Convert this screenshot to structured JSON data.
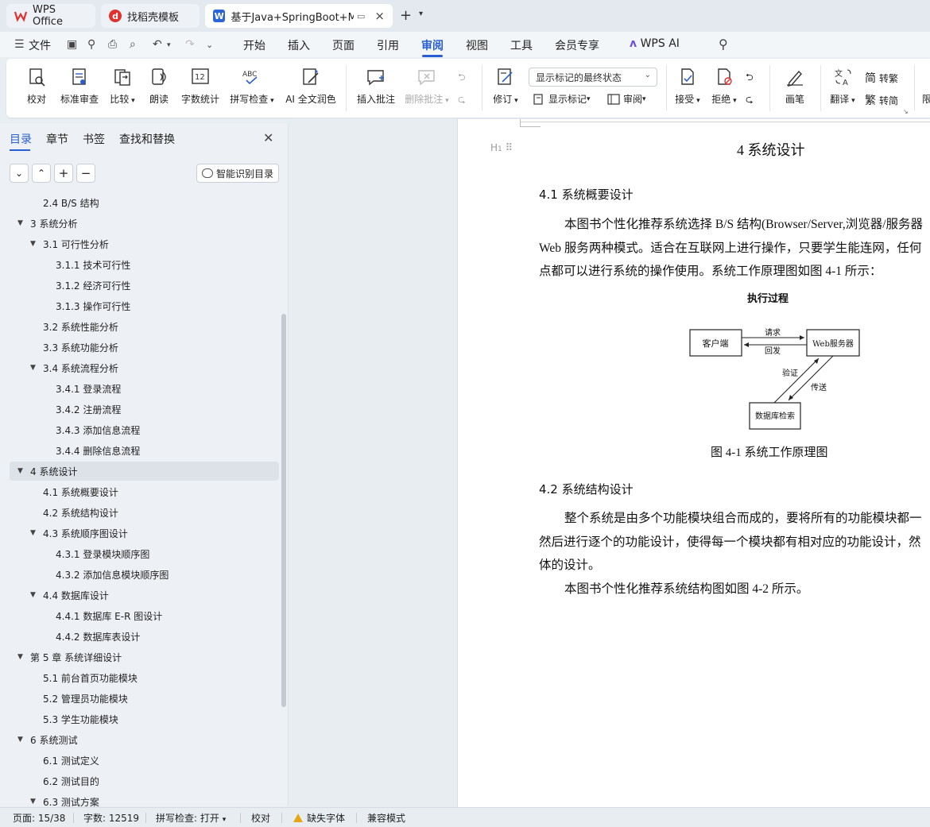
{
  "tabs": [
    {
      "label": "WPS Office",
      "icon": "wps-logo-icon"
    },
    {
      "label": "找稻壳模板",
      "icon": "docer-logo-icon"
    },
    {
      "label": "基于Java+SpringBoot+MyS",
      "icon": "writer-doc-icon",
      "active": true
    }
  ],
  "menu": {
    "file": "文件",
    "items": [
      "开始",
      "插入",
      "页面",
      "引用",
      "审阅",
      "视图",
      "工具",
      "会员专享"
    ],
    "active": "审阅",
    "wps_ai": "WPS AI"
  },
  "ribbon": {
    "proofread": "校对",
    "standard_review": "标准审查",
    "compare": "比较",
    "read_aloud": "朗读",
    "word_count": "字数统计",
    "spell_check": "拼写检查",
    "ai_polish": "AI 全文润色",
    "insert_comment": "插入批注",
    "delete_comment": "删除批注",
    "revise": "修订",
    "markup_select": "显示标记的最终状态",
    "show_markup": "显示标记",
    "review": "审阅",
    "accept": "接受",
    "reject": "拒绝",
    "pen": "画笔",
    "translate": "翻译",
    "to_traditional": "转繁",
    "to_simplified": "转简",
    "overflow": "限"
  },
  "nav": {
    "tabs": [
      "目录",
      "章节",
      "书签",
      "查找和替换"
    ],
    "active_tab": "目录",
    "smart_button": "智能识别目录",
    "toc": [
      {
        "text": "2.4 B/S 结构",
        "level": 2,
        "expander": false
      },
      {
        "text": "3  系统分析",
        "level": 1,
        "expander": true
      },
      {
        "text": "3.1  可行性分析",
        "level": 2,
        "expander": true
      },
      {
        "text": "3.1.1  技术可行性",
        "level": 3,
        "expander": false
      },
      {
        "text": "3.1.2 经济可行性",
        "level": 3,
        "expander": false
      },
      {
        "text": "3.1.3 操作可行性",
        "level": 3,
        "expander": false
      },
      {
        "text": "3.2  系统性能分析",
        "level": 2,
        "expander": false
      },
      {
        "text": "3.3  系统功能分析",
        "level": 2,
        "expander": false
      },
      {
        "text": "3.4 系统流程分析",
        "level": 2,
        "expander": true
      },
      {
        "text": "3.4.1 登录流程",
        "level": 3,
        "expander": false
      },
      {
        "text": "3.4.2 注册流程",
        "level": 3,
        "expander": false
      },
      {
        "text": "3.4.3 添加信息流程",
        "level": 3,
        "expander": false
      },
      {
        "text": "3.4.4 删除信息流程",
        "level": 3,
        "expander": false
      },
      {
        "text": "4   系统设计",
        "level": 1,
        "expander": true,
        "selected": true
      },
      {
        "text": "4.1 系统概要设计",
        "level": 2,
        "expander": false
      },
      {
        "text": "4.2 系统结构设计",
        "level": 2,
        "expander": false
      },
      {
        "text": "4.3 系统顺序图设计",
        "level": 2,
        "expander": true
      },
      {
        "text": "4.3.1 登录模块顺序图",
        "level": 3,
        "expander": false
      },
      {
        "text": "4.3.2 添加信息模块顺序图",
        "level": 3,
        "expander": false
      },
      {
        "text": "4.4 数据库设计",
        "level": 2,
        "expander": true
      },
      {
        "text": "4.4.1 数据库 E-R 图设计",
        "level": 3,
        "expander": false
      },
      {
        "text": "4.4.2 数据库表设计",
        "level": 3,
        "expander": false
      },
      {
        "text": "第 5 章  系统详细设计",
        "level": 1,
        "expander": true
      },
      {
        "text": "5.1 前台首页功能模块",
        "level": 2,
        "expander": false
      },
      {
        "text": "5.2 管理员功能模块",
        "level": 2,
        "expander": false
      },
      {
        "text": "5.3 学生功能模块",
        "level": 2,
        "expander": false
      },
      {
        "text": "6  系统测试",
        "level": 1,
        "expander": true
      },
      {
        "text": "6.1  测试定义",
        "level": 2,
        "expander": false
      },
      {
        "text": "6.2  测试目的",
        "level": 2,
        "expander": false
      },
      {
        "text": "6.3 测试方案",
        "level": 2,
        "expander": true
      }
    ]
  },
  "document": {
    "heading_marker": "H1",
    "chapter_title": "4   系统设计",
    "sec1_title": "4.1 系统概要设计",
    "sec1_lines": [
      "本图书个性化推荐系统选择 B/S 结构(Browser/Server,浏览器/服务器",
      "Web 服务两种模式。适合在互联网上进行操作，只要学生能连网，任何",
      "点都可以进行系统的操作使用。系统工作原理图如图 4-1 所示："
    ],
    "figure": {
      "title": "执行过程",
      "client": "客户端",
      "server": "Web服务器",
      "db": "数据库检索",
      "request": "请求",
      "reply": "回发",
      "verify": "验证",
      "transfer": "传送",
      "caption": "图 4-1  系统工作原理图"
    },
    "sec2_title": "4.2 系统结构设计",
    "sec2_lines": [
      "整个系统是由多个功能模块组合而成的，要将所有的功能模块都一",
      "然后进行逐个的功能设计，使得每一个模块都有相对应的功能设计，然",
      "体的设计。",
      "本图书个性化推荐系统结构图如图 4-2 所示。"
    ]
  },
  "status": {
    "page": "页面: 15/38",
    "words": "字数: 12519",
    "spell": "拼写检查: 打开",
    "proof": "校对",
    "missing_font": "缺失字体",
    "compat": "兼容模式"
  },
  "colors": {
    "accent": "#2a5fd1",
    "wps_red": "#e0312f",
    "writer_blue": "#2b63d9"
  }
}
